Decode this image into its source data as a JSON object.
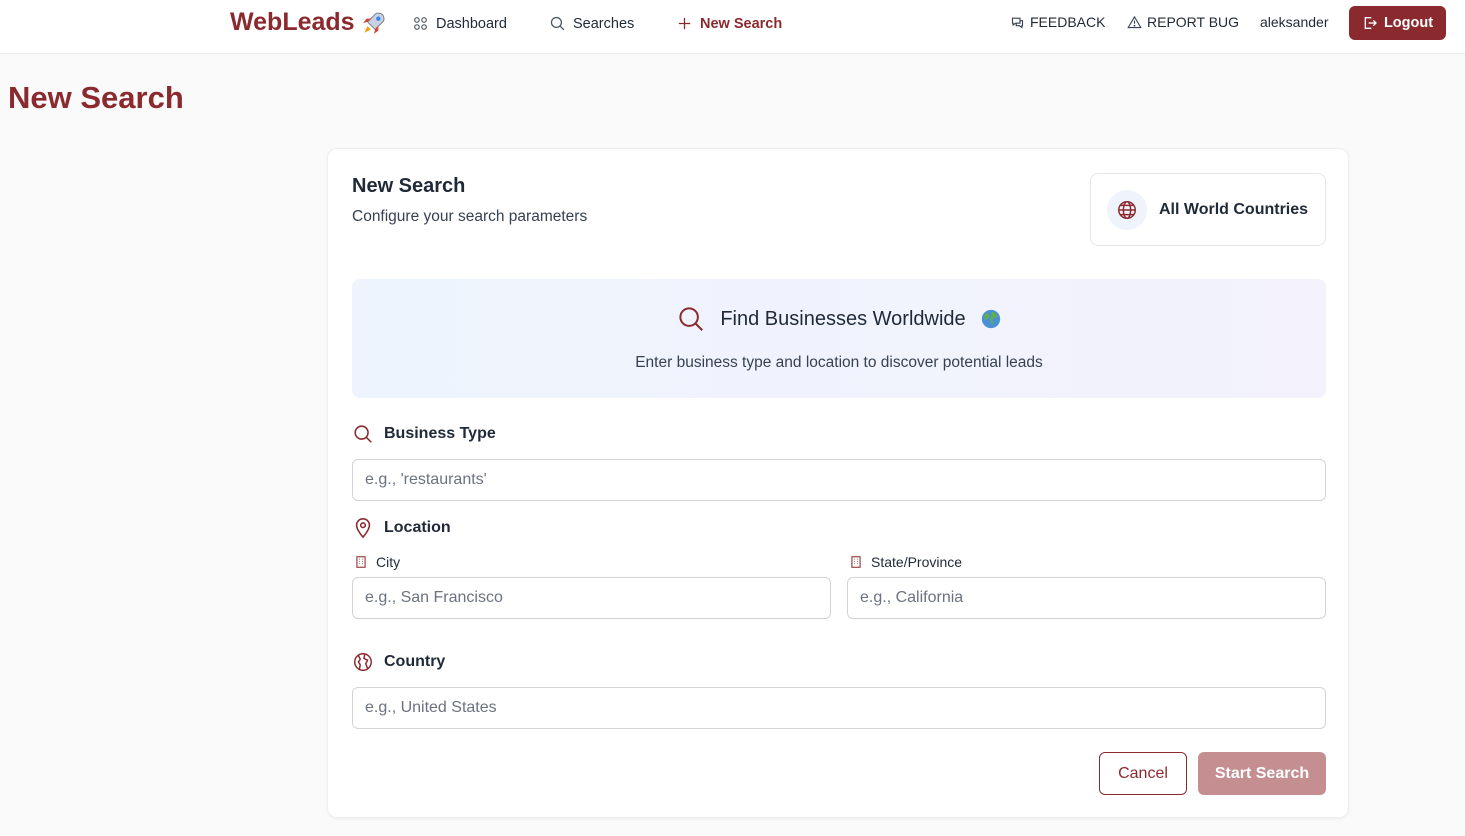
{
  "header": {
    "brand": "WebLeads",
    "nav": [
      {
        "label": "Dashboard",
        "icon": "grid-icon"
      },
      {
        "label": "Searches",
        "icon": "search-icon"
      },
      {
        "label": "New Search",
        "icon": "plus-icon",
        "active": true
      }
    ],
    "feedback": "FEEDBACK",
    "report_bug": "REPORT BUG",
    "username": "aleksander",
    "logout": "Logout"
  },
  "page": {
    "title": "New Search"
  },
  "card": {
    "title": "New Search",
    "subtitle": "Configure your search parameters",
    "countries_label": "All World Countries"
  },
  "banner": {
    "title": "Find Businesses Worldwide",
    "subtitle": "Enter business type and location to discover potential leads"
  },
  "form": {
    "business_type": {
      "label": "Business Type",
      "placeholder": "e.g., 'restaurants'",
      "value": ""
    },
    "location": {
      "label": "Location"
    },
    "city": {
      "label": "City",
      "placeholder": "e.g., San Francisco",
      "value": ""
    },
    "state": {
      "label": "State/Province",
      "placeholder": "e.g., California",
      "value": ""
    },
    "country": {
      "label": "Country",
      "placeholder": "e.g., United States",
      "value": ""
    },
    "cancel": "Cancel",
    "start": "Start Search"
  },
  "colors": {
    "brand": "#8b2a2e",
    "start_disabled": "#c58e91"
  }
}
